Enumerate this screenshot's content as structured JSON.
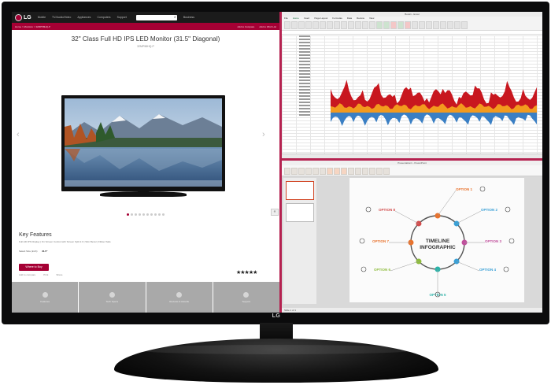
{
  "monitor": {
    "brand": "LG"
  },
  "website": {
    "logo": "LG",
    "nav": [
      "Mobile",
      "TV/Audio/Video",
      "Appliances",
      "Computers",
      "Support"
    ],
    "search_placeholder": "",
    "account_label": "Business",
    "breadcrumb": "Home > Monitors > 32MP58HQ-P",
    "compare_label": "Add to Compare",
    "wishlist_label": "Add to Wish List",
    "product_title": "32\" Class Full HD IPS LED Monitor (31.5\" Diagonal)",
    "product_model": "32MP58HQ-P",
    "key_features_title": "Key Features",
    "key_features_text": "Full HD IPS Display | On Screen Control with Screen Split 2.0 | Slim Bezel | Flicker Safe",
    "size_label": "Select Size (inch):",
    "size_value": "31.5\"",
    "where_to_buy": "Where to Buy",
    "rating_stars": "★★★★★",
    "sub_links": [
      "Add to compare",
      "Print",
      "Share"
    ],
    "tiles": [
      {
        "label": "Features"
      },
      {
        "label": "Tech Specs"
      },
      {
        "label": "Reviews & Awards"
      },
      {
        "label": "Support"
      }
    ]
  },
  "excel": {
    "title": "Book1 - Excel",
    "tabs": [
      "File",
      "Home",
      "Insert",
      "Page Layout",
      "Formulas",
      "Data",
      "Review",
      "View"
    ],
    "active_tab": "Home",
    "colors": {
      "red": "#c8171f",
      "orange": "#f39a1e",
      "blue": "#3a7fc4"
    }
  },
  "powerpoint": {
    "title": "Presentation1 - PowerPoint",
    "slide_title": "TIMELINE INFOGRAPHIC",
    "options": [
      "OPTION 1",
      "OPTION 2",
      "OPTION 3",
      "OPTION 4",
      "OPTION 5",
      "OPTION 6",
      "OPTION 7",
      "OPTION 8"
    ],
    "status": "Slide 1 of 1"
  }
}
